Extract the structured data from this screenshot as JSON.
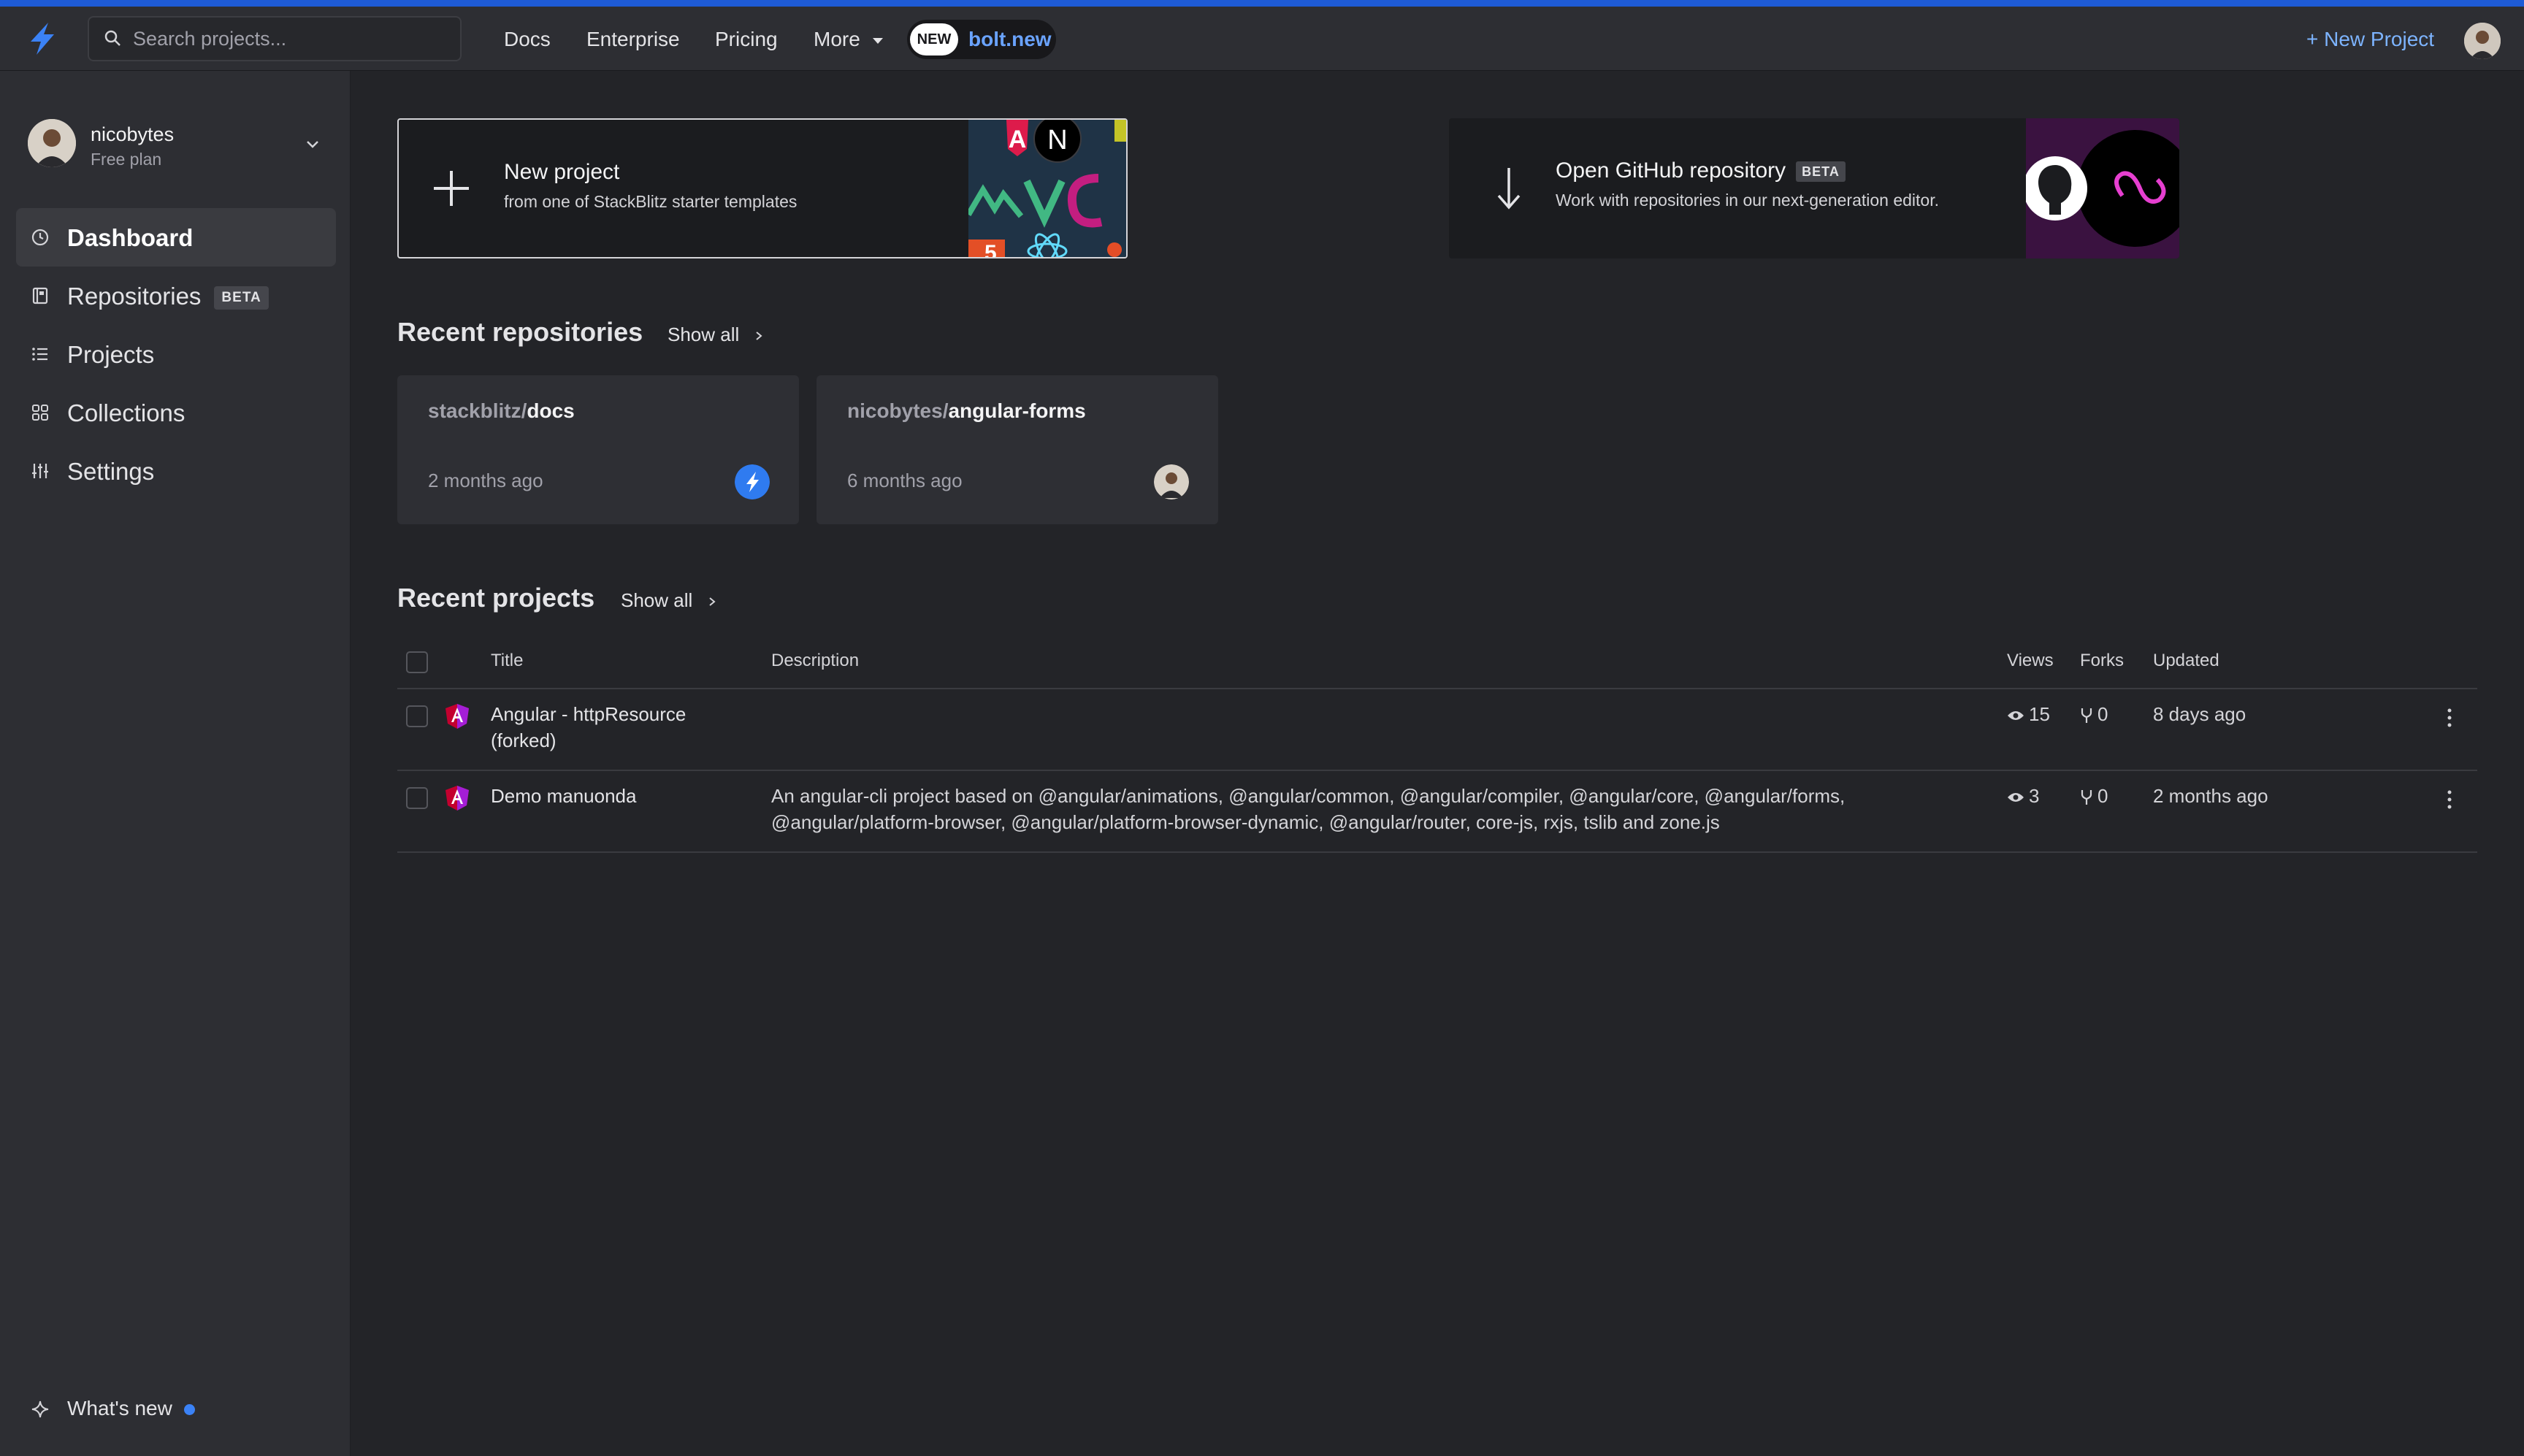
{
  "topbar": {
    "search_placeholder": "Search projects...",
    "nav": [
      "Docs",
      "Enterprise",
      "Pricing",
      "More"
    ],
    "bolt_badge": "NEW",
    "bolt_label": "bolt.new",
    "new_project": "+ New Project"
  },
  "sidebar": {
    "user_name": "nicobytes",
    "plan": "Free plan",
    "items": [
      {
        "label": "Dashboard",
        "icon": "clock-icon",
        "active": true
      },
      {
        "label": "Repositories",
        "icon": "repo-icon",
        "badge": "BETA"
      },
      {
        "label": "Projects",
        "icon": "list-icon"
      },
      {
        "label": "Collections",
        "icon": "grid-icon"
      },
      {
        "label": "Settings",
        "icon": "sliders-icon"
      }
    ],
    "whats_new": "What's new"
  },
  "cards": {
    "new_project": {
      "title": "New project",
      "subtitle": "from one of StackBlitz starter templates"
    },
    "github": {
      "title": "Open GitHub repository",
      "badge": "BETA",
      "subtitle": "Work with repositories in our next-generation editor."
    }
  },
  "recent_repositories": {
    "heading": "Recent repositories",
    "show_all": "Show all",
    "items": [
      {
        "owner": "stackblitz/",
        "repo": "docs",
        "time": "2 months ago"
      },
      {
        "owner": "nicobytes/",
        "repo": "angular-forms",
        "time": "6 months ago"
      }
    ]
  },
  "recent_projects": {
    "heading": "Recent projects",
    "show_all": "Show all",
    "columns": {
      "title": "Title",
      "description": "Description",
      "views": "Views",
      "forks": "Forks",
      "updated": "Updated"
    },
    "rows": [
      {
        "title_line1": "Angular - httpResource",
        "title_line2": "(forked)",
        "desc_line1": "",
        "desc_line2": "",
        "views": "15",
        "forks": "0",
        "updated": "8 days ago"
      },
      {
        "title_line1": "Demo manuonda",
        "title_line2": "",
        "desc_line1": "An angular-cli project based on @angular/animations, @angular/common, @angular/compiler, @angular/core, @angular/forms,",
        "desc_line2": "@angular/platform-browser, @angular/platform-browser-dynamic, @angular/router, core-js, rxjs, tslib and zone.js",
        "views": "3",
        "forks": "0",
        "updated": "2 months ago"
      }
    ]
  },
  "colors": {
    "accent": "#3b82f6",
    "link": "#7db4ff",
    "background": "#232428",
    "sidebar": "#2d2e33"
  }
}
